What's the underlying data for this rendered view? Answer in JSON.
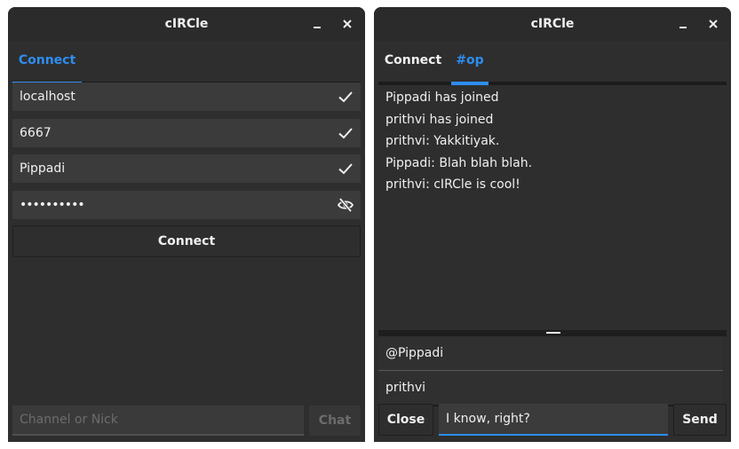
{
  "left_window": {
    "title": "cIRCle",
    "tabs": [
      {
        "label": "Connect",
        "active": true
      }
    ],
    "server_field": {
      "value": "localhost"
    },
    "port_field": {
      "value": "6667"
    },
    "nick_field": {
      "value": "Pippadi"
    },
    "password_field": {
      "value": "••••••••••"
    },
    "connect_button": "Connect",
    "channel_input": {
      "placeholder": "Channel or Nick"
    },
    "chat_button": "Chat"
  },
  "right_window": {
    "title": "cIRCle",
    "tabs": [
      {
        "label": "Connect",
        "active": false
      },
      {
        "label": "#op",
        "active": true
      }
    ],
    "messages": [
      "Pippadi has joined",
      "prithvi has joined",
      "prithvi: Yakkitiyak.",
      "Pippadi: Blah blah blah.",
      "prithvi: cIRCle is cool!"
    ],
    "users": [
      "@Pippadi",
      "prithvi"
    ],
    "close_button": "Close",
    "message_input": {
      "value": "I know, right?"
    },
    "send_button": "Send"
  },
  "colors": {
    "accent": "#2d8ef0",
    "window_bg": "#2e2e2e",
    "field_bg": "#3b3b3b"
  }
}
